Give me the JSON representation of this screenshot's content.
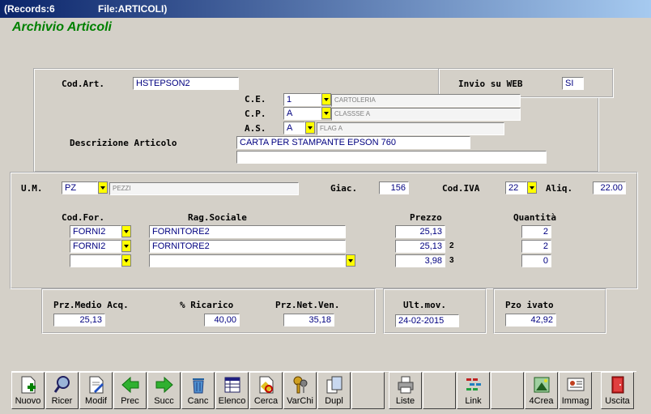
{
  "titlebar": {
    "records": "(Records:6",
    "file": "File:ARTICOLI)"
  },
  "heading": "Archivio Articoli",
  "article": {
    "cod_art_label": "Cod.Art.",
    "cod_art": "HSTEPSON2",
    "invio_web_label": "Invio su WEB",
    "invio_web": "SI",
    "ce_label": "C.E.",
    "ce_code": "1",
    "ce_desc": "CARTOLERIA",
    "cp_label": "C.P.",
    "cp_code": "A",
    "cp_desc": "CLASSSE A",
    "as_label": "A.S.",
    "as_code": "A",
    "as_desc": "FLAG A",
    "desc_label": "Descrizione Articolo",
    "desc_line1": "CARTA PER STAMPANTE EPSON 760",
    "desc_line2": ""
  },
  "stock": {
    "um_label": "U.M.",
    "um_code": "PZ",
    "um_desc": "PEZZI",
    "giac_label": "Giac.",
    "giac": "156",
    "codiva_label": "Cod.IVA",
    "codiva": "22",
    "aliq_label": "Aliq.",
    "aliq": "22.00"
  },
  "suppliers": {
    "col_codfor": "Cod.For.",
    "col_ragsoc": "Rag.Sociale",
    "col_prezzo": "Prezzo",
    "col_qta": "Quantità",
    "rows": [
      {
        "cod": "FORNI2",
        "rag": "FORNITORE2",
        "prezzo": "25,13",
        "num": "",
        "qta": "2"
      },
      {
        "cod": "FORNI2",
        "rag": "FORNITORE2",
        "prezzo": "25,13",
        "num": "2",
        "qta": "2"
      },
      {
        "cod": "",
        "rag": "",
        "prezzo": "3,98",
        "num": "3",
        "qta": "0"
      }
    ]
  },
  "pricing": {
    "medio_label": "Prz.Medio Acq.",
    "medio": "25,13",
    "ricarico_label": "% Ricarico",
    "ricarico": "40,00",
    "netven_label": "Prz.Net.Ven.",
    "netven": "35,18",
    "ultmov_label": "Ult.mov.",
    "ultmov": "24-02-2015",
    "ivato_label": "Pzo ivato",
    "ivato": "42,92"
  },
  "toolbar": {
    "nuovo": "Nuovo",
    "ricer": "Ricer",
    "modif": "Modif",
    "prec": "Prec",
    "succ": "Succ",
    "canc": "Canc",
    "elenco": "Elenco",
    "cerca": "Cerca",
    "varchi": "VarChi",
    "dupl": "Dupl",
    "liste": "Liste",
    "link": "Link",
    "crea4": "4Crea",
    "immag": "Immag",
    "uscita": "Uscita"
  }
}
